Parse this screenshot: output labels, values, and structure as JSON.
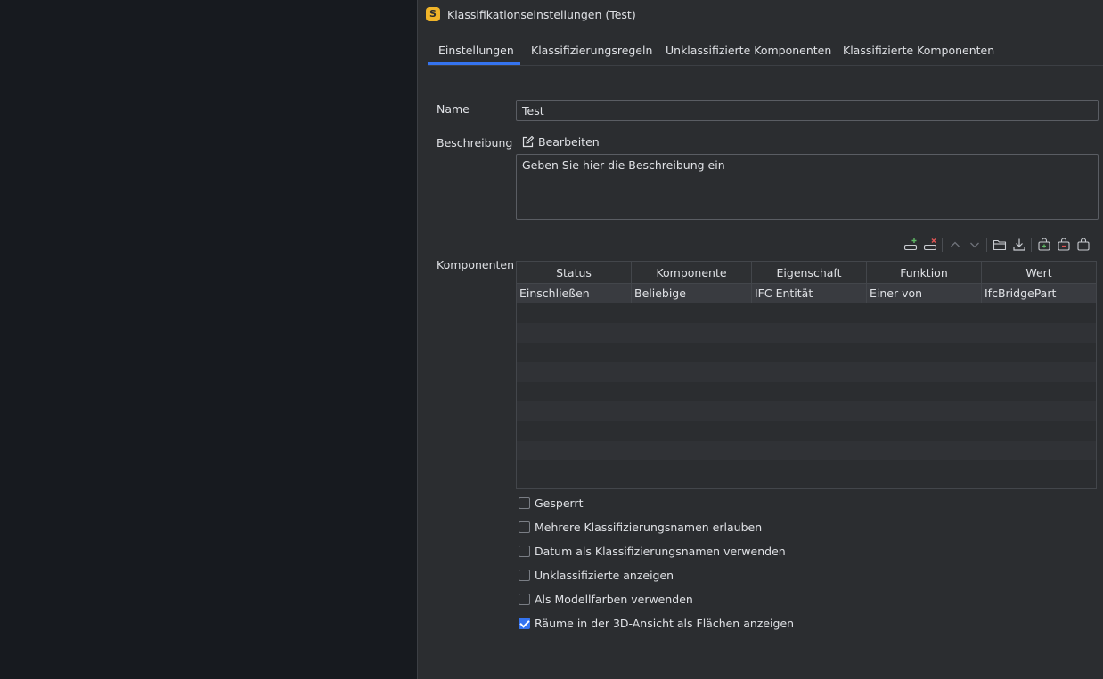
{
  "window": {
    "title": "Klassifikationseinstellungen (Test)",
    "app_icon_letter": "S"
  },
  "tabs": [
    {
      "label": "Einstellungen",
      "active": true
    },
    {
      "label": "Klassifizierungsregeln",
      "active": false
    },
    {
      "label": "Unklassifizierte Komponenten",
      "active": false
    },
    {
      "label": "Klassifizierte Komponenten",
      "active": false
    }
  ],
  "form": {
    "name_label": "Name",
    "name_value": "Test",
    "description_label": "Beschreibung",
    "edit_label": "Bearbeiten",
    "description_value": "Geben Sie hier die Beschreibung ein",
    "components_label": "Komponenten"
  },
  "toolbar": {
    "icons": [
      "add-row-icon",
      "remove-row-icon",
      "move-up-icon",
      "move-down-icon",
      "open-folder-icon",
      "import-icon",
      "bag-add-icon",
      "bag-remove-icon",
      "bag-icon"
    ]
  },
  "table": {
    "columns": [
      "Status",
      "Komponente",
      "Eigenschaft",
      "Funktion",
      "Wert"
    ],
    "rows": [
      [
        "Einschließen",
        "Beliebige",
        "IFC Entität",
        "Einer von",
        "IfcBridgePart"
      ]
    ]
  },
  "options": [
    {
      "label": "Gesperrt",
      "checked": false
    },
    {
      "label": "Mehrere Klassifizierungsnamen erlauben",
      "checked": false
    },
    {
      "label": "Datum als Klassifizierungsnamen verwenden",
      "checked": false
    },
    {
      "label": "Unklassifizierte anzeigen",
      "checked": false
    },
    {
      "label": "Als Modellfarben verwenden",
      "checked": false
    },
    {
      "label": "Räume in der 3D-Ansicht als Flächen anzeigen",
      "checked": true
    }
  ],
  "colors": {
    "accent": "#3574f0",
    "background": "#2b2d30",
    "app_icon": "#f0b429"
  }
}
